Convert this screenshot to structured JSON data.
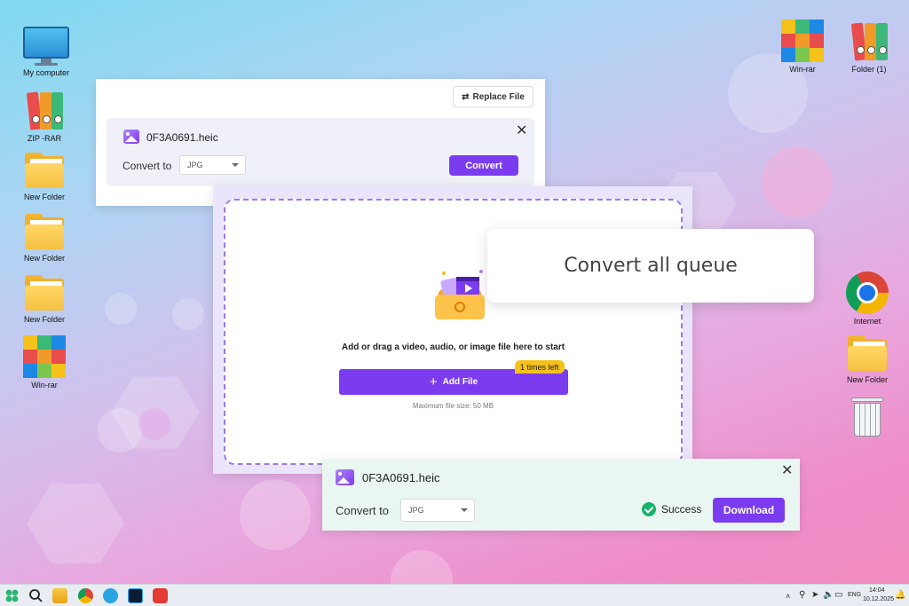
{
  "desktop": {
    "left_icons": [
      {
        "label": "My computer"
      },
      {
        "label": "ZIP -RAR"
      },
      {
        "label": "New Folder"
      },
      {
        "label": "New Folder"
      },
      {
        "label": "New Folder"
      },
      {
        "label": "Win-rar"
      }
    ],
    "top_right_icons": [
      {
        "label": "Win-rar"
      },
      {
        "label": "Folder (1)"
      }
    ],
    "right_icons": [
      {
        "label": "Internet"
      },
      {
        "label": "New Folder"
      },
      {
        "label": ""
      }
    ]
  },
  "panel_top": {
    "replace_label": "Replace File",
    "file_name": "0F3A0691.heic",
    "convert_to_label": "Convert to",
    "format_value": "JPG",
    "convert_button": "Convert",
    "close_glyph": "✕"
  },
  "dropzone": {
    "instruction": "Add or drag a video, audio, or image file here to start",
    "add_button": "Add File",
    "badge": "1 times left",
    "max_size": "Maximum file size: 50 MB"
  },
  "callout": {
    "text": "Convert all queue"
  },
  "panel_bottom": {
    "file_name": "0F3A0691.heic",
    "convert_to_label": "Convert to",
    "format_value": "JPG",
    "status": "Success",
    "download_button": "Download",
    "close_glyph": "✕"
  },
  "taskbar": {
    "language": "ENG",
    "time": "14:04",
    "date": "10.12.2025"
  },
  "colors": {
    "accent": "#7b3cf0",
    "success": "#17b26a",
    "badge": "#f5c21b"
  }
}
